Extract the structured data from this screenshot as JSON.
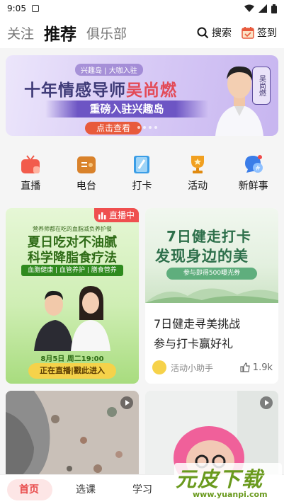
{
  "status_bar": {
    "time": "9:05"
  },
  "header": {
    "tabs": [
      {
        "label": "关注"
      },
      {
        "label": "推荐"
      },
      {
        "label": "俱乐部"
      }
    ],
    "search_label": "搜索",
    "checkin_label": "签到"
  },
  "banner": {
    "brand": "兴趣岛 | 大咖入驻",
    "title_prefix": "十年情感导师",
    "title_highlight": "吴尚燃",
    "subtitle": "重磅入驻兴趣岛",
    "cta": "点击查看",
    "name_tag": "吴尚燃"
  },
  "quick_nav": [
    {
      "label": "直播",
      "icon": "tv-icon"
    },
    {
      "label": "电台",
      "icon": "radio-icon"
    },
    {
      "label": "打卡",
      "icon": "checkin-book-icon"
    },
    {
      "label": "活动",
      "icon": "trophy-icon"
    },
    {
      "label": "新鲜事",
      "icon": "chat-bubble-icon"
    }
  ],
  "cards": [
    {
      "live_badge": "直播中",
      "poster_top": "营养师都在吃的血脂减负养护餐",
      "poster_title1": "夏日吃对不油腻",
      "poster_title2": "科学降脂食疗法",
      "poster_tags": "血脂健康 | 血管养护 | 膳食营养",
      "poster_date": "8月5日 周二19:00",
      "poster_cta": "正在直播|戳此进入"
    },
    {
      "poster_title1": "7日健走打卡",
      "poster_title2": "发现身边的美",
      "poster_pill": "参与即得500曝光券",
      "text_line1": "7日健走寻美挑战",
      "text_line2": "参与打卡赢好礼",
      "author": "活动小助手",
      "likes": "1.9k"
    }
  ],
  "bottom_nav": {
    "items": [
      {
        "label": "首页"
      },
      {
        "label": "选课"
      },
      {
        "label": "学习"
      }
    ]
  },
  "watermark": {
    "text": "元皮下载",
    "url": "www.yuanpi.com"
  },
  "colors": {
    "accent": "#e84a4a",
    "green": "#2e6b16"
  }
}
